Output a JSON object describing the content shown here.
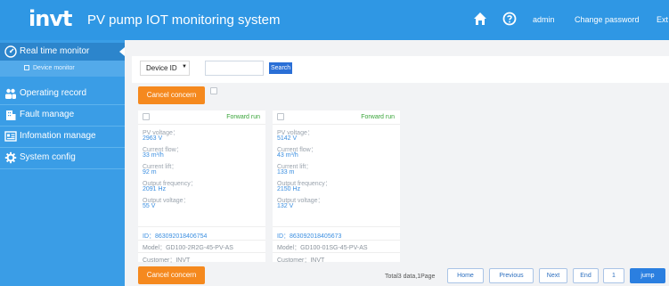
{
  "header": {
    "logo": "invt",
    "title": "PV pump IOT monitoring system",
    "user": "admin",
    "change_password": "Change password",
    "exit": "Ext"
  },
  "sidebar": {
    "items": [
      {
        "label": "Real time monitor",
        "icon": "speedometer-icon"
      },
      {
        "label": "Device monitor",
        "icon": "square-icon"
      },
      {
        "label": "Operating record",
        "icon": "people-icon"
      },
      {
        "label": "Fault manage",
        "icon": "building-icon"
      },
      {
        "label": "Infomation manage",
        "icon": "info-card-icon"
      },
      {
        "label": "System config",
        "icon": "gear-icon"
      }
    ]
  },
  "search": {
    "select_value": "Device ID",
    "input_value": "",
    "button": "Search"
  },
  "actions": {
    "cancel_concern": "Cancel concern"
  },
  "cards": [
    {
      "status": "Forward run",
      "pv_voltage_label": "PV voltage：",
      "pv_voltage": "2963 V",
      "current_flow_label": "Current flow：",
      "current_flow": "33 m³/h",
      "current_lift_label": "Current lift：",
      "current_lift": "92 m",
      "output_frequency_label": "Output frequency：",
      "output_frequency": "2091 Hz",
      "output_voltage_label": "Output voltage：",
      "output_voltage": "55 V",
      "id": "ID：863092018406754",
      "model": "Model：GD100-2R2G-45-PV-AS",
      "customer": "Customer：INVT"
    },
    {
      "status": "Forward run",
      "pv_voltage_label": "PV voltage：",
      "pv_voltage": "5142 V",
      "current_flow_label": "Current flow：",
      "current_flow": "43 m³/h",
      "current_lift_label": "Current lift：",
      "current_lift": "133 m",
      "output_frequency_label": "Output frequency：",
      "output_frequency": "2150 Hz",
      "output_voltage_label": "Output voltage：",
      "output_voltage": "132 V",
      "id": "ID：863092018405673",
      "model": "Model：GD100-01SG-45-PV-AS",
      "customer": "Customer：INVT"
    }
  ],
  "pager": {
    "info": "Total3 data,1Page",
    "home": "Home",
    "previous": "Previous",
    "next": "Next",
    "end": "End",
    "page_value": "1",
    "jump": "jump"
  },
  "colors": {
    "header_bg": "#2f97e4",
    "sidebar_bg": "#3a9de6",
    "accent_orange": "#f5891e",
    "status_green": "#3aa53a",
    "value_blue": "#3a8ee0"
  }
}
